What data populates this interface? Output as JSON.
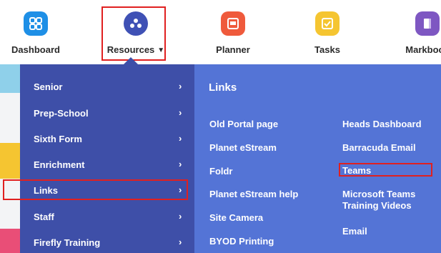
{
  "nav": {
    "dashboard": "Dashboard",
    "resources": "Resources",
    "planner": "Planner",
    "tasks": "Tasks",
    "markbook": "Markbook"
  },
  "menu": {
    "items": [
      {
        "label": "Senior"
      },
      {
        "label": "Prep-School"
      },
      {
        "label": "Sixth Form"
      },
      {
        "label": "Enrichment"
      },
      {
        "label": "Links"
      },
      {
        "label": "Staff"
      },
      {
        "label": "Firefly Training"
      }
    ],
    "arrow": "›"
  },
  "links": {
    "title": "Links",
    "col1": [
      "Old Portal page",
      "Planet eStream",
      "Foldr",
      "Planet eStream help",
      "Site Camera",
      "BYOD Printing"
    ],
    "col2": [
      "Heads Dashboard",
      "Barracuda Email",
      "Teams",
      "Microsoft Teams Training Videos",
      "Email"
    ]
  },
  "colors": {
    "dashboard": "#1e8fe6",
    "resources": "#3f51b5",
    "planner": "#ef5a3c",
    "tasks": "#f5c531",
    "markbook": "#7e57c2",
    "highlight": "#e02020"
  }
}
